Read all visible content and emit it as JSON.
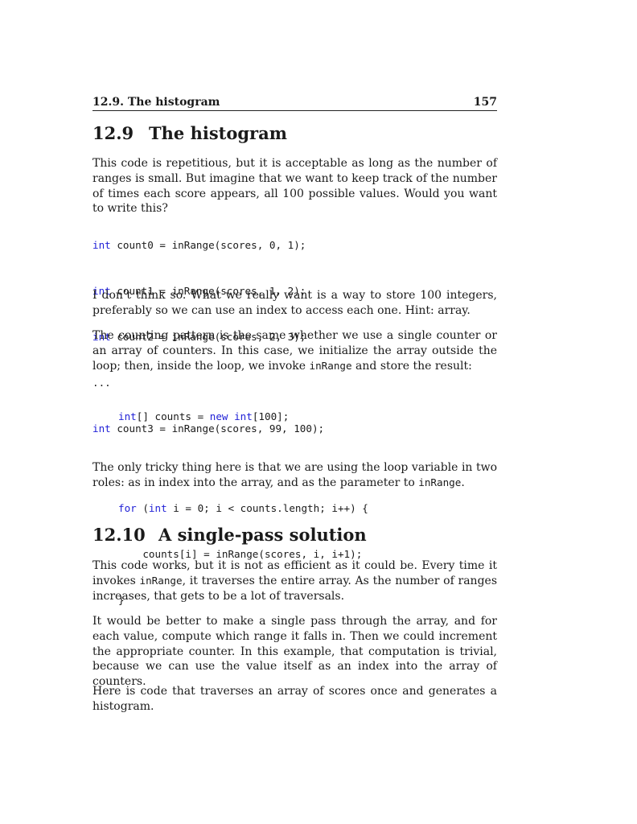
{
  "header": {
    "section_label": "12.9.  The histogram",
    "page_number": "157"
  },
  "section1": {
    "number": "12.9",
    "title": "The histogram",
    "para1": "This code is repetitious, but it is acceptable as long as the number of ranges is small.  But imagine that we want to keep track of the number of times each score appears, all 100 possible values.  Would you want to write this?",
    "code1": [
      {
        "kw": "int",
        "rest": " count0 = inRange(scores, 0, 1);"
      },
      {
        "kw": "int",
        "rest": " count1 = inRange(scores, 1, 2);"
      },
      {
        "kw": "int",
        "rest": " count2 = inRange(scores, 2, 3);"
      },
      {
        "kw": "",
        "rest": "..."
      },
      {
        "kw": "int",
        "rest": " count3 = inRange(scores, 99, 100);"
      }
    ],
    "para2": "I don’t think so.  What we really want is a way to store 100 integers, preferably so we can use an index to access each one.  Hint: array.",
    "para3_a": "The counting pattern is the same whether we use a single counter or an array of counters.  In this case, we initialize the array outside the loop; then, inside the loop, we invoke ",
    "para3_code": "inRange",
    "para3_b": " and store the result:",
    "code2": [
      {
        "kw": "int",
        "rest": "[] counts = ",
        "kw2": "new",
        "rest2": " ",
        "kw3": "int",
        "rest3": "[100];"
      },
      {
        "kw": "",
        "rest": ""
      },
      {
        "kw": "for",
        "rest": " (",
        "kw2": "int",
        "rest2": " i = 0; i < counts.length; i++) {"
      },
      {
        "kw": "",
        "rest": "    counts[i] = inRange(scores, i, i+1);"
      },
      {
        "kw": "",
        "rest": "}"
      }
    ],
    "para4_a": "The only tricky thing here is that we are using the loop variable in two roles: as in index into the array, and as the parameter to ",
    "para4_code": "inRange",
    "para4_b": "."
  },
  "section2": {
    "number": "12.10",
    "title": "A single-pass solution",
    "para1_a": "This code works, but it is not as efficient as it could be.  Every time it invokes ",
    "para1_code": "inRange",
    "para1_b": ", it traverses the entire array.  As the number of ranges increases, that gets to be a lot of traversals.",
    "para2": "It would be better to make a single pass through the array, and for each value, compute which range it falls in.  Then we could increment the appropriate counter.  In this example, that computation is trivial, because we can use the value itself as an index into the array of counters.",
    "para3": "Here is code that traverses an array of scores once and generates a histogram."
  },
  "colors": {
    "keyword": "#1f1fd6",
    "text": "#1a1a1a"
  }
}
